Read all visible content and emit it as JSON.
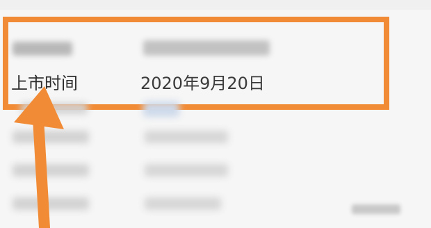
{
  "detail_rows": [
    {
      "label": "",
      "value": ""
    },
    {
      "label": "上市时间",
      "value": "2020年9月20日"
    }
  ],
  "annotation": {
    "box_color": "#f28b35",
    "arrow_color": "#f28b35"
  }
}
